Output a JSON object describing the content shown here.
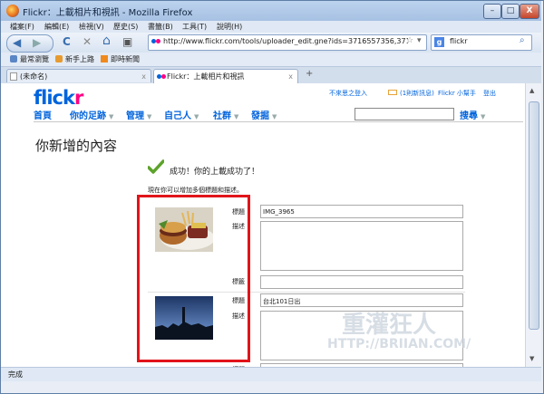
{
  "window": {
    "title": "Flickr：上載相片和視訊 - Mozilla Firefox",
    "min": "–",
    "max": "□",
    "close": "X"
  },
  "menu": [
    "檔案(F)",
    "編輯(E)",
    "檢視(V)",
    "歷史(S)",
    "書籤(B)",
    "工具(T)",
    "說明(H)"
  ],
  "nav": {
    "back_icon": "◀",
    "forward_icon": "▶",
    "reload_icon": "C",
    "stop_icon": "✕",
    "home_icon": "⌂",
    "feed_icon": "▣",
    "url": "http://www.flickr.com/tools/uploader_edit.gne?ids=3716557356,3715743",
    "star_icon": "☆",
    "url_dropdown": "▾",
    "search_value": "flickr",
    "search_engine_icon": "g",
    "search_icon": "⌕"
  },
  "bookmarks": [
    "最常瀏覽",
    "新手上路",
    "即時新聞"
  ],
  "tabs": [
    {
      "label": "(未命名)",
      "close": "x"
    },
    {
      "label": "Flickr：上載相片和視訊",
      "close": "x"
    }
  ],
  "new_tab": "+",
  "status": "完成",
  "flickr": {
    "logo_a": "flick",
    "logo_b": "r",
    "account": "不來思之登入",
    "mail": "(1則新訊息)",
    "help": "Flickr 小幫手",
    "logout": "登出",
    "nav": [
      "首頁",
      "你的足跡",
      "管理",
      "自己人",
      "社群",
      "發掘"
    ],
    "search_btn": "搜尋",
    "page_title": "你新增的內容",
    "success": "成功！你的上載成功了！",
    "intro": "現在你可以增加多個標題和描述。",
    "photos": [
      {
        "title_label": "標題",
        "title_value": "IMG_3965",
        "desc_label": "描述",
        "tags_label": "標籤"
      },
      {
        "title_label": "標題",
        "title_value": "台北101日出",
        "desc_label": "描述",
        "tags_label": "標籤"
      }
    ],
    "next_label": "標題"
  },
  "watermark": {
    "cn": "重灌狂人",
    "url": "HTTP://BRIIAN.COM/"
  },
  "colors": {
    "flickr_blue": "#0063dc",
    "flickr_pink": "#ff0084",
    "highlight_red": "#e1141a"
  }
}
